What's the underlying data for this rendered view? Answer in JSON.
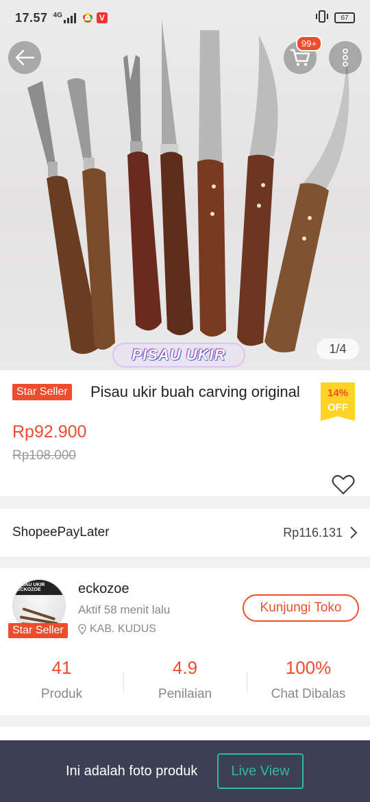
{
  "status_bar": {
    "time": "17.57",
    "network": "4G",
    "battery": "67"
  },
  "hero": {
    "stamp_text": "PISAU UKIR",
    "image_counter": "1/4",
    "cart_badge": "99+"
  },
  "product": {
    "star_badge": "Star Seller",
    "title": "Pisau ukir buah carving original",
    "discount_pct": "14%",
    "discount_off": "OFF",
    "price": "Rp92.900",
    "original_price": "Rp108.000"
  },
  "paylater": {
    "label": "ShopeePayLater",
    "amount": "Rp116.131"
  },
  "shop": {
    "avatar_text": "PISAU UKIR ECKOZOE",
    "star_badge": "Star Seller",
    "name": "eckozoe",
    "active": "Aktif 58 menit lalu",
    "location": "KAB. KUDUS",
    "visit_button": "Kunjungi Toko",
    "stats": [
      {
        "value": "41",
        "label": "Produk"
      },
      {
        "value": "4.9",
        "label": "Penilaian"
      },
      {
        "value": "100%",
        "label": "Chat Dibalas"
      }
    ]
  },
  "bottom_bar": {
    "text": "Ini adalah foto produk",
    "live_button": "Live View"
  },
  "colors": {
    "accent": "#ee4d2d",
    "badge_yellow": "#ffd424",
    "bottom_bar": "#3c4055",
    "live_view": "#2fb9a3"
  },
  "icons": [
    "back-arrow-icon",
    "cart-icon",
    "more-vertical-icon",
    "heart-icon",
    "chevron-right-icon",
    "location-pin-icon",
    "vibrate-icon",
    "battery-icon",
    "signal-icon",
    "chrome-icon",
    "vivaldi-icon"
  ]
}
